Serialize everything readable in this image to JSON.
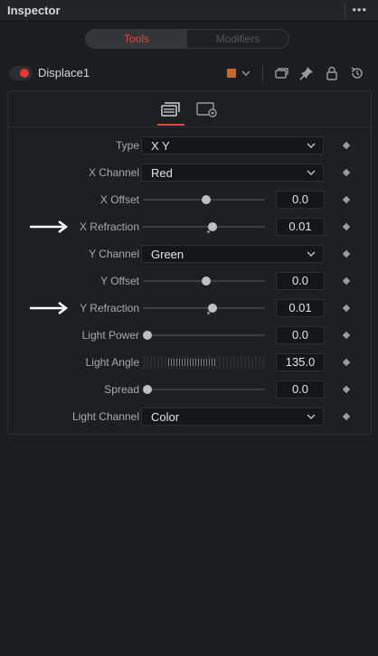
{
  "header": {
    "title": "Inspector",
    "menu_icon": "more-dots-icon",
    "menu_glyph": "•••"
  },
  "tabs": [
    {
      "label": "Tools",
      "active": true
    },
    {
      "label": "Modifiers",
      "active": false
    }
  ],
  "node": {
    "name": "Displace1",
    "enabled": true,
    "color_swatch": "#c6692c",
    "toolbar_icons": [
      "versions-icon",
      "pin-icon",
      "lock-icon",
      "reset-icon"
    ]
  },
  "subtabs": [
    "controls-tab-icon",
    "settings-tab-icon"
  ],
  "controls": {
    "type": {
      "label": "Type",
      "value": "X Y"
    },
    "x_channel": {
      "label": "X Channel",
      "value": "Red"
    },
    "x_offset": {
      "label": "X Offset",
      "value": "0.0",
      "slider_fraction": 0.5
    },
    "x_refraction": {
      "label": "X Refraction",
      "value": "0.01",
      "slider_fraction": 0.55
    },
    "y_channel": {
      "label": "Y Channel",
      "value": "Green"
    },
    "y_offset": {
      "label": "Y Offset",
      "value": "0.0",
      "slider_fraction": 0.5
    },
    "y_refraction": {
      "label": "Y Refraction",
      "value": "0.01",
      "slider_fraction": 0.55
    },
    "light_power": {
      "label": "Light Power",
      "value": "0.0",
      "slider_fraction": 0.0
    },
    "light_angle": {
      "label": "Light Angle",
      "value": "135.0"
    },
    "spread": {
      "label": "Spread",
      "value": "0.0",
      "slider_fraction": 0.0
    },
    "light_channel": {
      "label": "Light Channel",
      "value": "Color"
    }
  },
  "colors": {
    "accent": "#e0493c",
    "panel": "#1e1f22",
    "background": "#1c1d20"
  }
}
